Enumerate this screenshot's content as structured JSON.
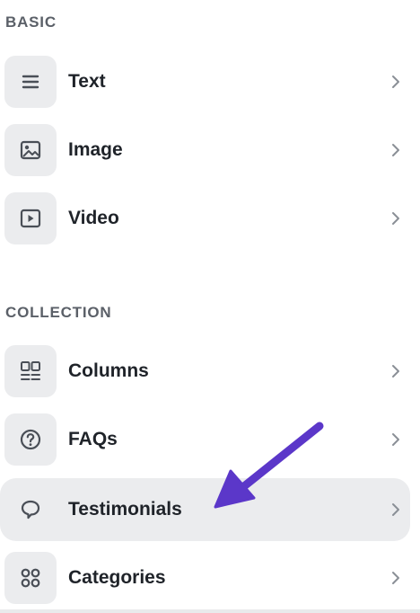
{
  "sections": {
    "basic": {
      "title": "BASIC"
    },
    "collection": {
      "title": "COLLECTION"
    }
  },
  "items": [
    {
      "label": "Text",
      "icon": "text-lines-icon",
      "active": false
    },
    {
      "label": "Image",
      "icon": "image-icon",
      "active": false
    },
    {
      "label": "Video",
      "icon": "video-play-icon",
      "active": false
    },
    {
      "label": "Columns",
      "icon": "columns-grid-icon",
      "active": false
    },
    {
      "label": "FAQs",
      "icon": "question-circle-icon",
      "active": false
    },
    {
      "label": "Testimonials",
      "icon": "speech-bubble-icon",
      "active": true
    },
    {
      "label": "Categories",
      "icon": "four-circles-icon",
      "active": false
    }
  ],
  "colors": {
    "accent_arrow": "#5b37c9",
    "tile_background": "#ebecee",
    "section_title": "#5b6068",
    "label_text": "#1f2329",
    "chevron": "#8a8f96"
  }
}
